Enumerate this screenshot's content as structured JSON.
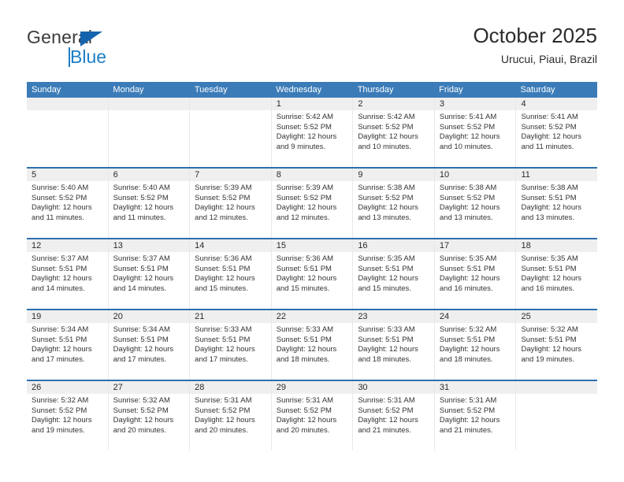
{
  "logo": {
    "word1": "General",
    "word2": "Blue",
    "triangle_color": "#1464ad",
    "blue_color": "#1d7ec4"
  },
  "header": {
    "title": "October 2025",
    "subtitle": "Urucui, Piaui, Brazil"
  },
  "theme": {
    "header_row_bg": "#3b7cb8",
    "row_separator": "#2f6fae",
    "daynum_band_bg": "#efefef",
    "text": "#333333"
  },
  "weekdays": [
    "Sunday",
    "Monday",
    "Tuesday",
    "Wednesday",
    "Thursday",
    "Friday",
    "Saturday"
  ],
  "weeks": [
    [
      {
        "day": "",
        "empty": true
      },
      {
        "day": "",
        "empty": true
      },
      {
        "day": "",
        "empty": true
      },
      {
        "day": "1",
        "sunrise": "Sunrise: 5:42 AM",
        "sunset": "Sunset: 5:52 PM",
        "daylight": "Daylight: 12 hours and 9 minutes."
      },
      {
        "day": "2",
        "sunrise": "Sunrise: 5:42 AM",
        "sunset": "Sunset: 5:52 PM",
        "daylight": "Daylight: 12 hours and 10 minutes."
      },
      {
        "day": "3",
        "sunrise": "Sunrise: 5:41 AM",
        "sunset": "Sunset: 5:52 PM",
        "daylight": "Daylight: 12 hours and 10 minutes."
      },
      {
        "day": "4",
        "sunrise": "Sunrise: 5:41 AM",
        "sunset": "Sunset: 5:52 PM",
        "daylight": "Daylight: 12 hours and 11 minutes."
      }
    ],
    [
      {
        "day": "5",
        "sunrise": "Sunrise: 5:40 AM",
        "sunset": "Sunset: 5:52 PM",
        "daylight": "Daylight: 12 hours and 11 minutes."
      },
      {
        "day": "6",
        "sunrise": "Sunrise: 5:40 AM",
        "sunset": "Sunset: 5:52 PM",
        "daylight": "Daylight: 12 hours and 11 minutes."
      },
      {
        "day": "7",
        "sunrise": "Sunrise: 5:39 AM",
        "sunset": "Sunset: 5:52 PM",
        "daylight": "Daylight: 12 hours and 12 minutes."
      },
      {
        "day": "8",
        "sunrise": "Sunrise: 5:39 AM",
        "sunset": "Sunset: 5:52 PM",
        "daylight": "Daylight: 12 hours and 12 minutes."
      },
      {
        "day": "9",
        "sunrise": "Sunrise: 5:38 AM",
        "sunset": "Sunset: 5:52 PM",
        "daylight": "Daylight: 12 hours and 13 minutes."
      },
      {
        "day": "10",
        "sunrise": "Sunrise: 5:38 AM",
        "sunset": "Sunset: 5:52 PM",
        "daylight": "Daylight: 12 hours and 13 minutes."
      },
      {
        "day": "11",
        "sunrise": "Sunrise: 5:38 AM",
        "sunset": "Sunset: 5:51 PM",
        "daylight": "Daylight: 12 hours and 13 minutes."
      }
    ],
    [
      {
        "day": "12",
        "sunrise": "Sunrise: 5:37 AM",
        "sunset": "Sunset: 5:51 PM",
        "daylight": "Daylight: 12 hours and 14 minutes."
      },
      {
        "day": "13",
        "sunrise": "Sunrise: 5:37 AM",
        "sunset": "Sunset: 5:51 PM",
        "daylight": "Daylight: 12 hours and 14 minutes."
      },
      {
        "day": "14",
        "sunrise": "Sunrise: 5:36 AM",
        "sunset": "Sunset: 5:51 PM",
        "daylight": "Daylight: 12 hours and 15 minutes."
      },
      {
        "day": "15",
        "sunrise": "Sunrise: 5:36 AM",
        "sunset": "Sunset: 5:51 PM",
        "daylight": "Daylight: 12 hours and 15 minutes."
      },
      {
        "day": "16",
        "sunrise": "Sunrise: 5:35 AM",
        "sunset": "Sunset: 5:51 PM",
        "daylight": "Daylight: 12 hours and 15 minutes."
      },
      {
        "day": "17",
        "sunrise": "Sunrise: 5:35 AM",
        "sunset": "Sunset: 5:51 PM",
        "daylight": "Daylight: 12 hours and 16 minutes."
      },
      {
        "day": "18",
        "sunrise": "Sunrise: 5:35 AM",
        "sunset": "Sunset: 5:51 PM",
        "daylight": "Daylight: 12 hours and 16 minutes."
      }
    ],
    [
      {
        "day": "19",
        "sunrise": "Sunrise: 5:34 AM",
        "sunset": "Sunset: 5:51 PM",
        "daylight": "Daylight: 12 hours and 17 minutes."
      },
      {
        "day": "20",
        "sunrise": "Sunrise: 5:34 AM",
        "sunset": "Sunset: 5:51 PM",
        "daylight": "Daylight: 12 hours and 17 minutes."
      },
      {
        "day": "21",
        "sunrise": "Sunrise: 5:33 AM",
        "sunset": "Sunset: 5:51 PM",
        "daylight": "Daylight: 12 hours and 17 minutes."
      },
      {
        "day": "22",
        "sunrise": "Sunrise: 5:33 AM",
        "sunset": "Sunset: 5:51 PM",
        "daylight": "Daylight: 12 hours and 18 minutes."
      },
      {
        "day": "23",
        "sunrise": "Sunrise: 5:33 AM",
        "sunset": "Sunset: 5:51 PM",
        "daylight": "Daylight: 12 hours and 18 minutes."
      },
      {
        "day": "24",
        "sunrise": "Sunrise: 5:32 AM",
        "sunset": "Sunset: 5:51 PM",
        "daylight": "Daylight: 12 hours and 18 minutes."
      },
      {
        "day": "25",
        "sunrise": "Sunrise: 5:32 AM",
        "sunset": "Sunset: 5:51 PM",
        "daylight": "Daylight: 12 hours and 19 minutes."
      }
    ],
    [
      {
        "day": "26",
        "sunrise": "Sunrise: 5:32 AM",
        "sunset": "Sunset: 5:52 PM",
        "daylight": "Daylight: 12 hours and 19 minutes."
      },
      {
        "day": "27",
        "sunrise": "Sunrise: 5:32 AM",
        "sunset": "Sunset: 5:52 PM",
        "daylight": "Daylight: 12 hours and 20 minutes."
      },
      {
        "day": "28",
        "sunrise": "Sunrise: 5:31 AM",
        "sunset": "Sunset: 5:52 PM",
        "daylight": "Daylight: 12 hours and 20 minutes."
      },
      {
        "day": "29",
        "sunrise": "Sunrise: 5:31 AM",
        "sunset": "Sunset: 5:52 PM",
        "daylight": "Daylight: 12 hours and 20 minutes."
      },
      {
        "day": "30",
        "sunrise": "Sunrise: 5:31 AM",
        "sunset": "Sunset: 5:52 PM",
        "daylight": "Daylight: 12 hours and 21 minutes."
      },
      {
        "day": "31",
        "sunrise": "Sunrise: 5:31 AM",
        "sunset": "Sunset: 5:52 PM",
        "daylight": "Daylight: 12 hours and 21 minutes."
      },
      {
        "day": "",
        "empty": true
      }
    ]
  ]
}
